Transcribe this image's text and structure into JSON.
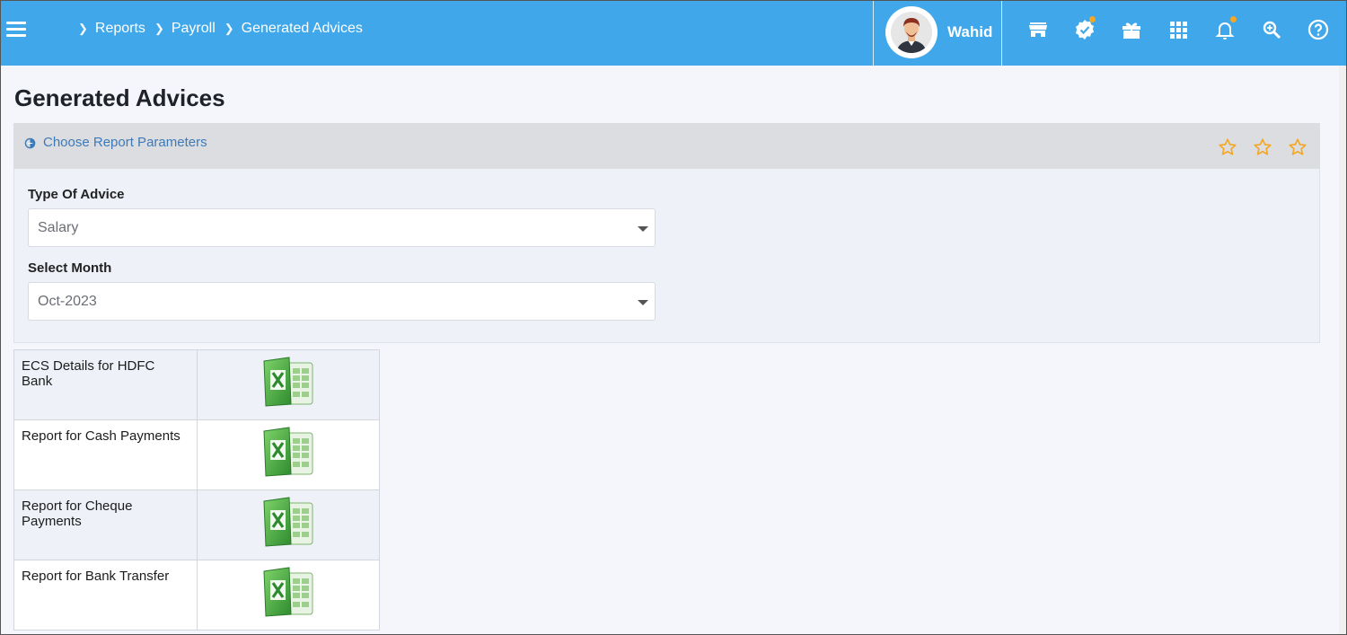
{
  "topbar": {
    "breadcrumbs": [
      "Reports",
      "Payroll",
      "Generated Advices"
    ],
    "user_name": "Wahid",
    "icons": [
      "store-icon",
      "verified-badge-icon",
      "gift-icon",
      "apps-grid-icon",
      "bell-icon",
      "search-zoom-icon",
      "help-icon"
    ],
    "notification_dot_color": "#f5a623",
    "bar_color": "#3fa7ea"
  },
  "page": {
    "title": "Generated Advices"
  },
  "parameters": {
    "header_link": "Choose Report Parameters",
    "star_color": "#f5a623",
    "fields": {
      "type_label": "Type Of Advice",
      "type_value": "Salary",
      "month_label": "Select Month",
      "month_value": "Oct-2023"
    }
  },
  "reports": [
    {
      "name": "ECS Details for HDFC Bank",
      "icon": "excel-icon"
    },
    {
      "name": "Report for Cash Payments",
      "icon": "excel-icon"
    },
    {
      "name": "Report for Cheque Payments",
      "icon": "excel-icon"
    },
    {
      "name": "Report for Bank Transfer",
      "icon": "excel-icon"
    }
  ]
}
